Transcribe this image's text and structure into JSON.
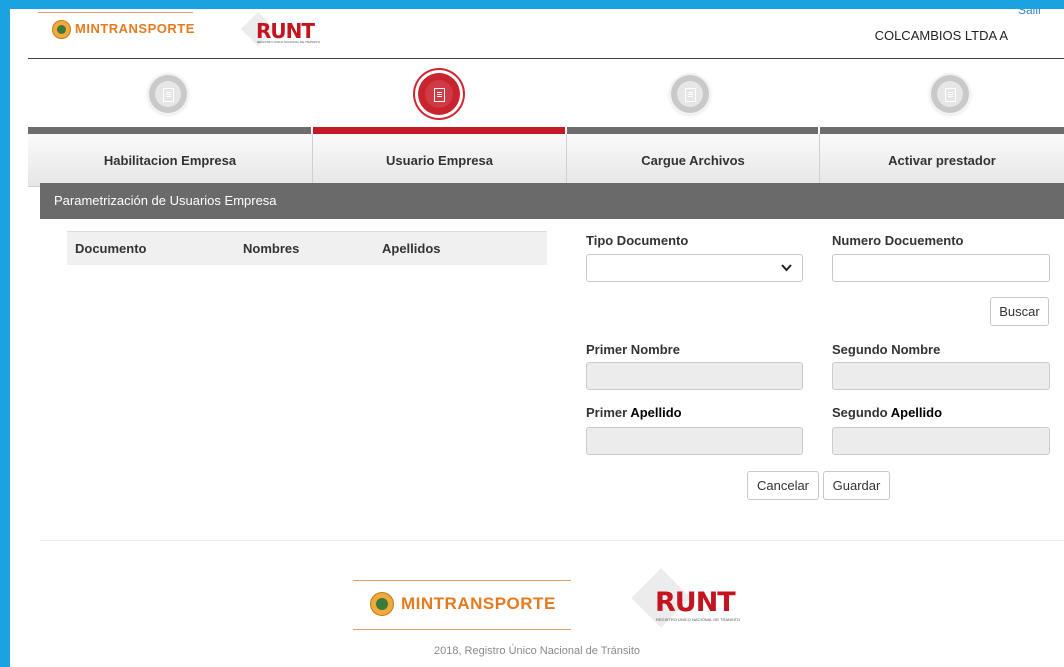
{
  "header": {
    "mintransporte_logo_text": "MINTRANSPORTE",
    "runt_logo_text": "RUNT",
    "runt_logo_subtitle": "REGISTRO ÚNICO NACIONAL DE TRÁNSITO",
    "logout_label": "Salir",
    "company_name": "COLCAMBIOS LTDA A"
  },
  "steps": [
    {
      "label": "Habilitacion Empresa",
      "active": false,
      "icon": "document-icon"
    },
    {
      "label": "Usuario Empresa",
      "active": true,
      "icon": "document-icon"
    },
    {
      "label": "Cargue Archivos",
      "active": false,
      "icon": "document-icon"
    },
    {
      "label": "Activar prestador",
      "active": false,
      "icon": "document-icon"
    }
  ],
  "panel": {
    "title": "Parametrización de Usuarios Empresa",
    "table_headers": [
      "Documento",
      "Nombres",
      "Apellidos"
    ]
  },
  "form": {
    "tipo_documento_label": "Tipo Documento",
    "tipo_documento_value": "",
    "numero_documento_label": "Numero Docuemento",
    "numero_documento_value": "",
    "buscar_label": "Buscar",
    "primer_nombre_label": "Primer Nombre",
    "segundo_nombre_label": "Segundo Nombre",
    "primer_apellido_label_a": "Primer ",
    "primer_apellido_label_b": "Apellido",
    "segundo_apellido_label_a": "Segundo ",
    "segundo_apellido_label_b": "Apellido",
    "cancelar_label": "Cancelar",
    "guardar_label": "Guardar"
  },
  "footer": {
    "mintransporte_logo_text": "MINTRANSPORTE",
    "runt_logo_text": "RUNT",
    "runt_logo_subtitle": "REGISTRO ÚNICO NACIONAL DE TRÁNSITO",
    "copyright": "2018, Registro Único Nacional de Tránsito"
  },
  "colors": {
    "frame_blue": "#1aa3e0",
    "active_red": "#c41a26",
    "brand_orange": "#e67a1e",
    "panel_header": "#6a6a6a"
  }
}
